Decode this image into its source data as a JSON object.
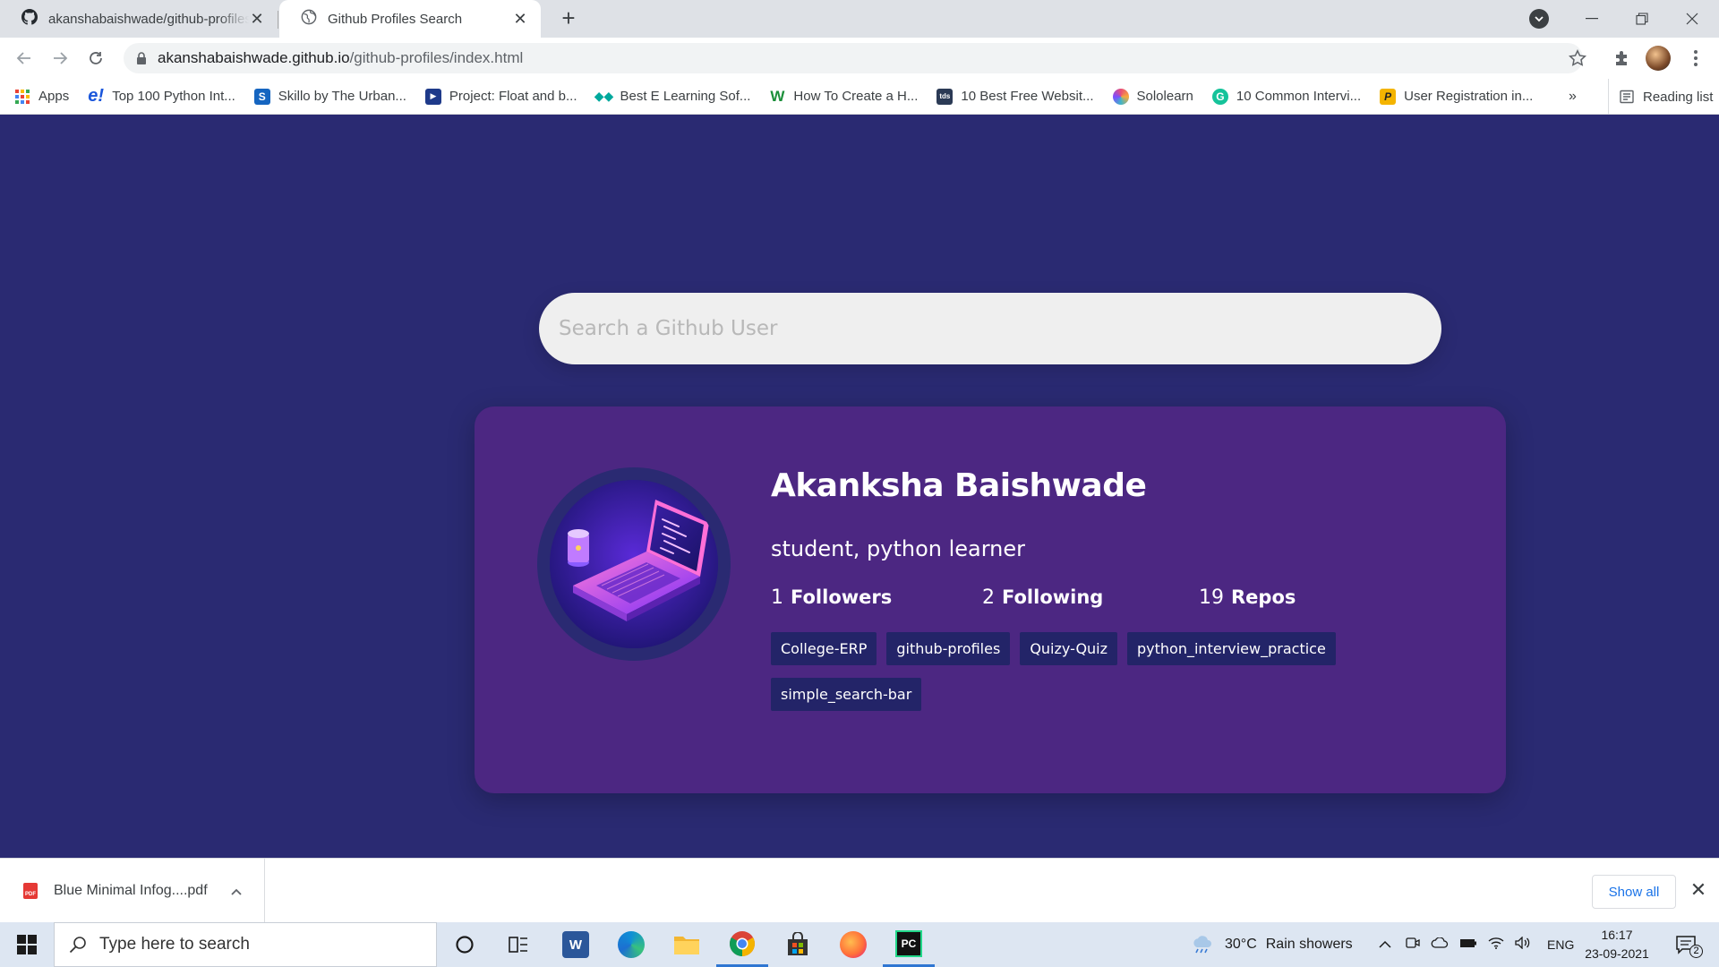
{
  "browser": {
    "tabs": [
      {
        "title": "akanshabaishwade/github-profiles",
        "active": false,
        "icon": "github-icon"
      },
      {
        "title": "Github Profiles Search",
        "active": true,
        "icon": "globe-icon"
      }
    ],
    "new_tab_label": "+",
    "address": {
      "host": "akanshabaishwade.github.io",
      "path": "/github-profiles/index.html"
    },
    "bookmarks": [
      {
        "label": "Apps",
        "icon": "apps-grid-icon",
        "color": "#4285f4"
      },
      {
        "label": "Top 100 Python Int...",
        "icon": "e-icon",
        "color": "#1a56db"
      },
      {
        "label": "Skillo by The Urban...",
        "icon": "skillo-icon",
        "color": "#1565c0"
      },
      {
        "label": "Project: Float and b...",
        "icon": "play-icon",
        "color": "#1e3a8a"
      },
      {
        "label": "Best E Learning Sof...",
        "icon": "diamond-icon",
        "color": "#00a99d"
      },
      {
        "label": "How To Create a H...",
        "icon": "w-icon",
        "color": "#1b8f3a"
      },
      {
        "label": "10 Best Free Websit...",
        "icon": "tds-icon",
        "color": "#2b3a55"
      },
      {
        "label": "Sololearn",
        "icon": "sololearn-icon",
        "color": "#e94e77"
      },
      {
        "label": "10 Common Intervi...",
        "icon": "grammarly-icon",
        "color": "#15c39a"
      },
      {
        "label": "User Registration in...",
        "icon": "p-icon",
        "color": "#f4b400"
      }
    ],
    "bookmarks_overflow": "»",
    "reading_list": "Reading list"
  },
  "page": {
    "search_placeholder": "Search a Github User",
    "profile": {
      "name": "Akanksha Baishwade",
      "bio": "student, python learner",
      "stats": [
        {
          "count": "1",
          "label": "Followers"
        },
        {
          "count": "2",
          "label": "Following"
        },
        {
          "count": "19",
          "label": "Repos"
        }
      ],
      "repos": [
        "College-ERP",
        "github-profiles",
        "Quizy-Quiz",
        "python_interview_practice",
        "simple_search-bar"
      ]
    }
  },
  "downloads": {
    "file_name": "Blue Minimal Infog....pdf",
    "file_badge": "PDF",
    "show_all": "Show all"
  },
  "taskbar": {
    "search_placeholder": "Type here to search",
    "apps": [
      {
        "name": "cortana",
        "icon": "cortana-icon"
      },
      {
        "name": "task-view",
        "icon": "task-view-icon"
      },
      {
        "name": "word",
        "icon": "word-icon",
        "letter": "W",
        "color": "#2b579a"
      },
      {
        "name": "edge",
        "icon": "edge-icon",
        "color": "#0f8fd6"
      },
      {
        "name": "file-explorer",
        "icon": "folder-icon",
        "color": "#f2b632"
      },
      {
        "name": "chrome",
        "icon": "chrome-icon",
        "running": true
      },
      {
        "name": "store",
        "icon": "store-icon",
        "color": "#333333"
      },
      {
        "name": "firefox",
        "icon": "firefox-icon",
        "color": "#ff7139"
      },
      {
        "name": "pycharm",
        "icon": "pycharm-icon",
        "letter": "PC",
        "color": "#111111",
        "running": true
      }
    ],
    "weather": {
      "temp": "30°C",
      "condition": "Rain showers"
    },
    "language": "ENG",
    "time": "16:17",
    "date": "23-09-2021",
    "notification_count": "2"
  }
}
